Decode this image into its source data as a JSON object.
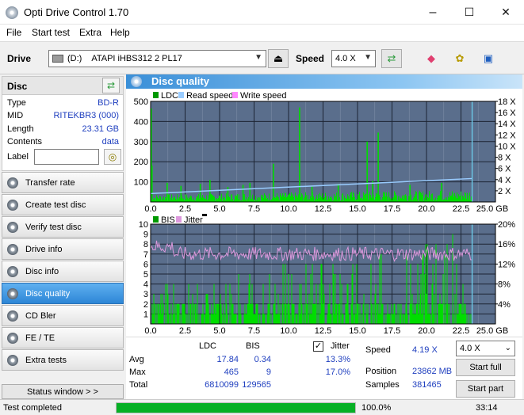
{
  "window": {
    "title": "Opti Drive Control 1.70",
    "minimize": "–",
    "maximize": "☐",
    "close": "✕"
  },
  "menu": [
    "File",
    "Start test",
    "Extra",
    "Help"
  ],
  "toolbar": {
    "drive_label": "Drive",
    "drive_letter": "(D:)",
    "drive_name": "ATAPI iHBS312  2 PL17",
    "speed_label": "Speed",
    "speed_value": "4.0 X"
  },
  "disc": {
    "title": "Disc",
    "fields": [
      {
        "key": "Type",
        "value": "BD-R"
      },
      {
        "key": "MID",
        "value": "RITEKBR3 (000)"
      },
      {
        "key": "Length",
        "value": "23.31 GB"
      },
      {
        "key": "Contents",
        "value": "data"
      }
    ],
    "label_key": "Label",
    "label_value": ""
  },
  "nav": [
    {
      "label": "Transfer rate",
      "active": false
    },
    {
      "label": "Create test disc",
      "active": false
    },
    {
      "label": "Verify test disc",
      "active": false
    },
    {
      "label": "Drive info",
      "active": false
    },
    {
      "label": "Disc info",
      "active": false
    },
    {
      "label": "Disc quality",
      "active": true
    },
    {
      "label": "CD Bler",
      "active": false
    },
    {
      "label": "FE / TE",
      "active": false
    },
    {
      "label": "Extra tests",
      "active": false
    }
  ],
  "status_window_btn": "Status window > >",
  "panel_title": "Disc quality",
  "chart_data": [
    {
      "type": "bar",
      "title": "",
      "legend": [
        "LDC",
        "Read speed",
        "Write speed"
      ],
      "colors": {
        "LDC": "#00dd00",
        "Read speed": "#99ccff",
        "Write speed": "#ff88ff"
      },
      "x_ticks": [
        "0.0",
        "2.5",
        "5.0",
        "7.5",
        "10.0",
        "12.5",
        "15.0",
        "17.5",
        "20.0",
        "22.5",
        "25.0 GB"
      ],
      "y_ticks_left": [
        "100",
        "200",
        "300",
        "400",
        "500"
      ],
      "y_ticks_right": [
        "2 X",
        "4 X",
        "6 X",
        "8 X",
        "10 X",
        "12 X",
        "14 X",
        "16 X",
        "18 X"
      ],
      "xlim": [
        0,
        25
      ],
      "ylim": [
        0,
        500
      ],
      "y2lim": [
        0,
        18
      ],
      "data_end_gb": 23.31,
      "ldc_base_range": [
        5,
        60
      ],
      "ldc_spikes": [
        {
          "x": 0.05,
          "y": 465
        },
        {
          "x": 0.1,
          "y": 180
        },
        {
          "x": 1.2,
          "y": 95
        },
        {
          "x": 2.2,
          "y": 80
        },
        {
          "x": 3.6,
          "y": 90
        },
        {
          "x": 4.3,
          "y": 110
        },
        {
          "x": 5.6,
          "y": 75
        },
        {
          "x": 6.7,
          "y": 85
        },
        {
          "x": 7.2,
          "y": 95
        },
        {
          "x": 8.9,
          "y": 190
        },
        {
          "x": 10.8,
          "y": 470
        },
        {
          "x": 11.7,
          "y": 80
        },
        {
          "x": 13.6,
          "y": 90
        },
        {
          "x": 15.7,
          "y": 300
        },
        {
          "x": 16.1,
          "y": 105
        },
        {
          "x": 16.5,
          "y": 345
        },
        {
          "x": 18.8,
          "y": 85
        },
        {
          "x": 21.1,
          "y": 95
        }
      ],
      "read_speed": {
        "start_gb": 0.0,
        "start_x": 1.5,
        "end_gb": 23.31,
        "end_x": 4.19
      }
    },
    {
      "type": "bar",
      "title": "",
      "legend": [
        "BIS",
        "Jitter"
      ],
      "colors": {
        "BIS": "#00dd00",
        "Jitter": "#dd99dd"
      },
      "x_ticks": [
        "0.0",
        "2.5",
        "5.0",
        "7.5",
        "10.0",
        "12.5",
        "15.0",
        "17.5",
        "20.0",
        "22.5",
        "25.0 GB"
      ],
      "y_ticks_left": [
        "1",
        "2",
        "3",
        "4",
        "5",
        "6",
        "7",
        "8",
        "9",
        "10"
      ],
      "y_ticks_right": [
        "4%",
        "8%",
        "12%",
        "16%",
        "20%"
      ],
      "xlim": [
        0,
        25
      ],
      "ylim": [
        0,
        10
      ],
      "y2lim": [
        0,
        20
      ],
      "data_end_gb": 23.31,
      "bis_max": 9,
      "jitter_range_pct": [
        12.0,
        17.0
      ],
      "jitter_avg_pct": 13.3
    }
  ],
  "stats": {
    "col_ldc": "LDC",
    "col_bis": "BIS",
    "rows": [
      {
        "label": "Avg",
        "ldc": "17.84",
        "bis": "0.34",
        "jitter": "13.3%"
      },
      {
        "label": "Max",
        "ldc": "465",
        "bis": "9",
        "jitter": "17.0%"
      },
      {
        "label": "Total",
        "ldc": "6810099",
        "bis": "129565",
        "jitter": ""
      }
    ],
    "jitter_label": "Jitter",
    "jitter_checked": true,
    "speed_label": "Speed",
    "speed_value": "4.19 X",
    "position_label": "Position",
    "position_value": "23862 MB",
    "samples_label": "Samples",
    "samples_value": "381465",
    "speed_select": "4.0 X",
    "start_full": "Start full",
    "start_part": "Start part"
  },
  "statusbar": {
    "text": "Test completed",
    "progress": 1.0,
    "progress_text": "100.0%",
    "time": "33:14"
  }
}
